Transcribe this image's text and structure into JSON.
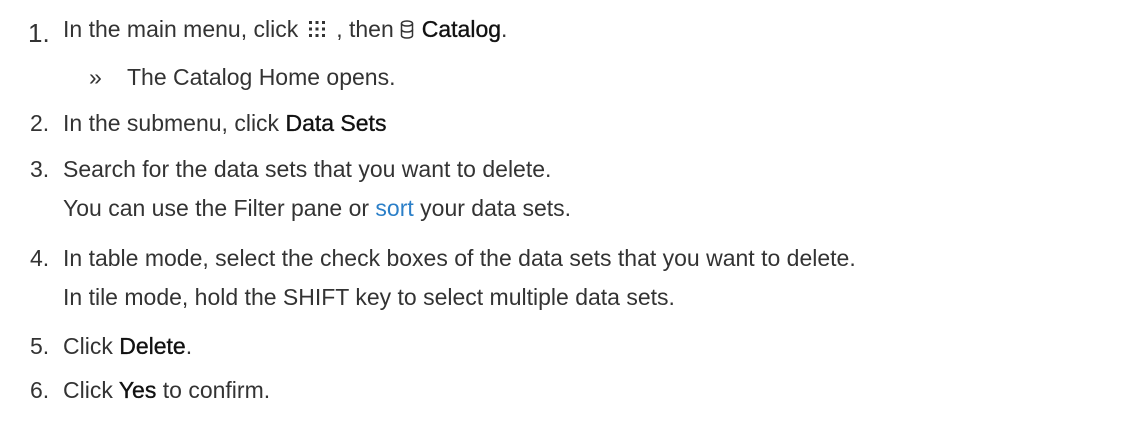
{
  "steps": [
    {
      "number": "1.",
      "text_before": "In the main menu, click",
      "text_middle": ", then",
      "emphasis": "Catalog",
      "text_after": ".",
      "icons": [
        "grid-icon",
        "database-icon"
      ],
      "result": {
        "marker": "»",
        "text": "The Catalog Home opens."
      }
    },
    {
      "number": "2.",
      "text_before": "In the submenu, click",
      "emphasis": "Data Sets"
    },
    {
      "number": "3.",
      "text": "Search for the data sets that you want to delete.",
      "sub_before": "You can use the Filter pane or",
      "sub_link": "sort",
      "sub_after": "your data sets."
    },
    {
      "number": "4.",
      "text": "In table mode, select the check boxes of the data sets that you want to delete.",
      "sub": "In tile mode, hold the SHIFT key to select multiple data sets."
    },
    {
      "number": "5.",
      "text_before": "Click",
      "emphasis": "Delete",
      "text_after": "."
    },
    {
      "number": "6.",
      "text_before": "Click",
      "emphasis": "Yes",
      "text_after": "to confirm."
    }
  ],
  "colors": {
    "text": "#333333",
    "emphasis": "#111111",
    "link": "#2b7fc8"
  }
}
